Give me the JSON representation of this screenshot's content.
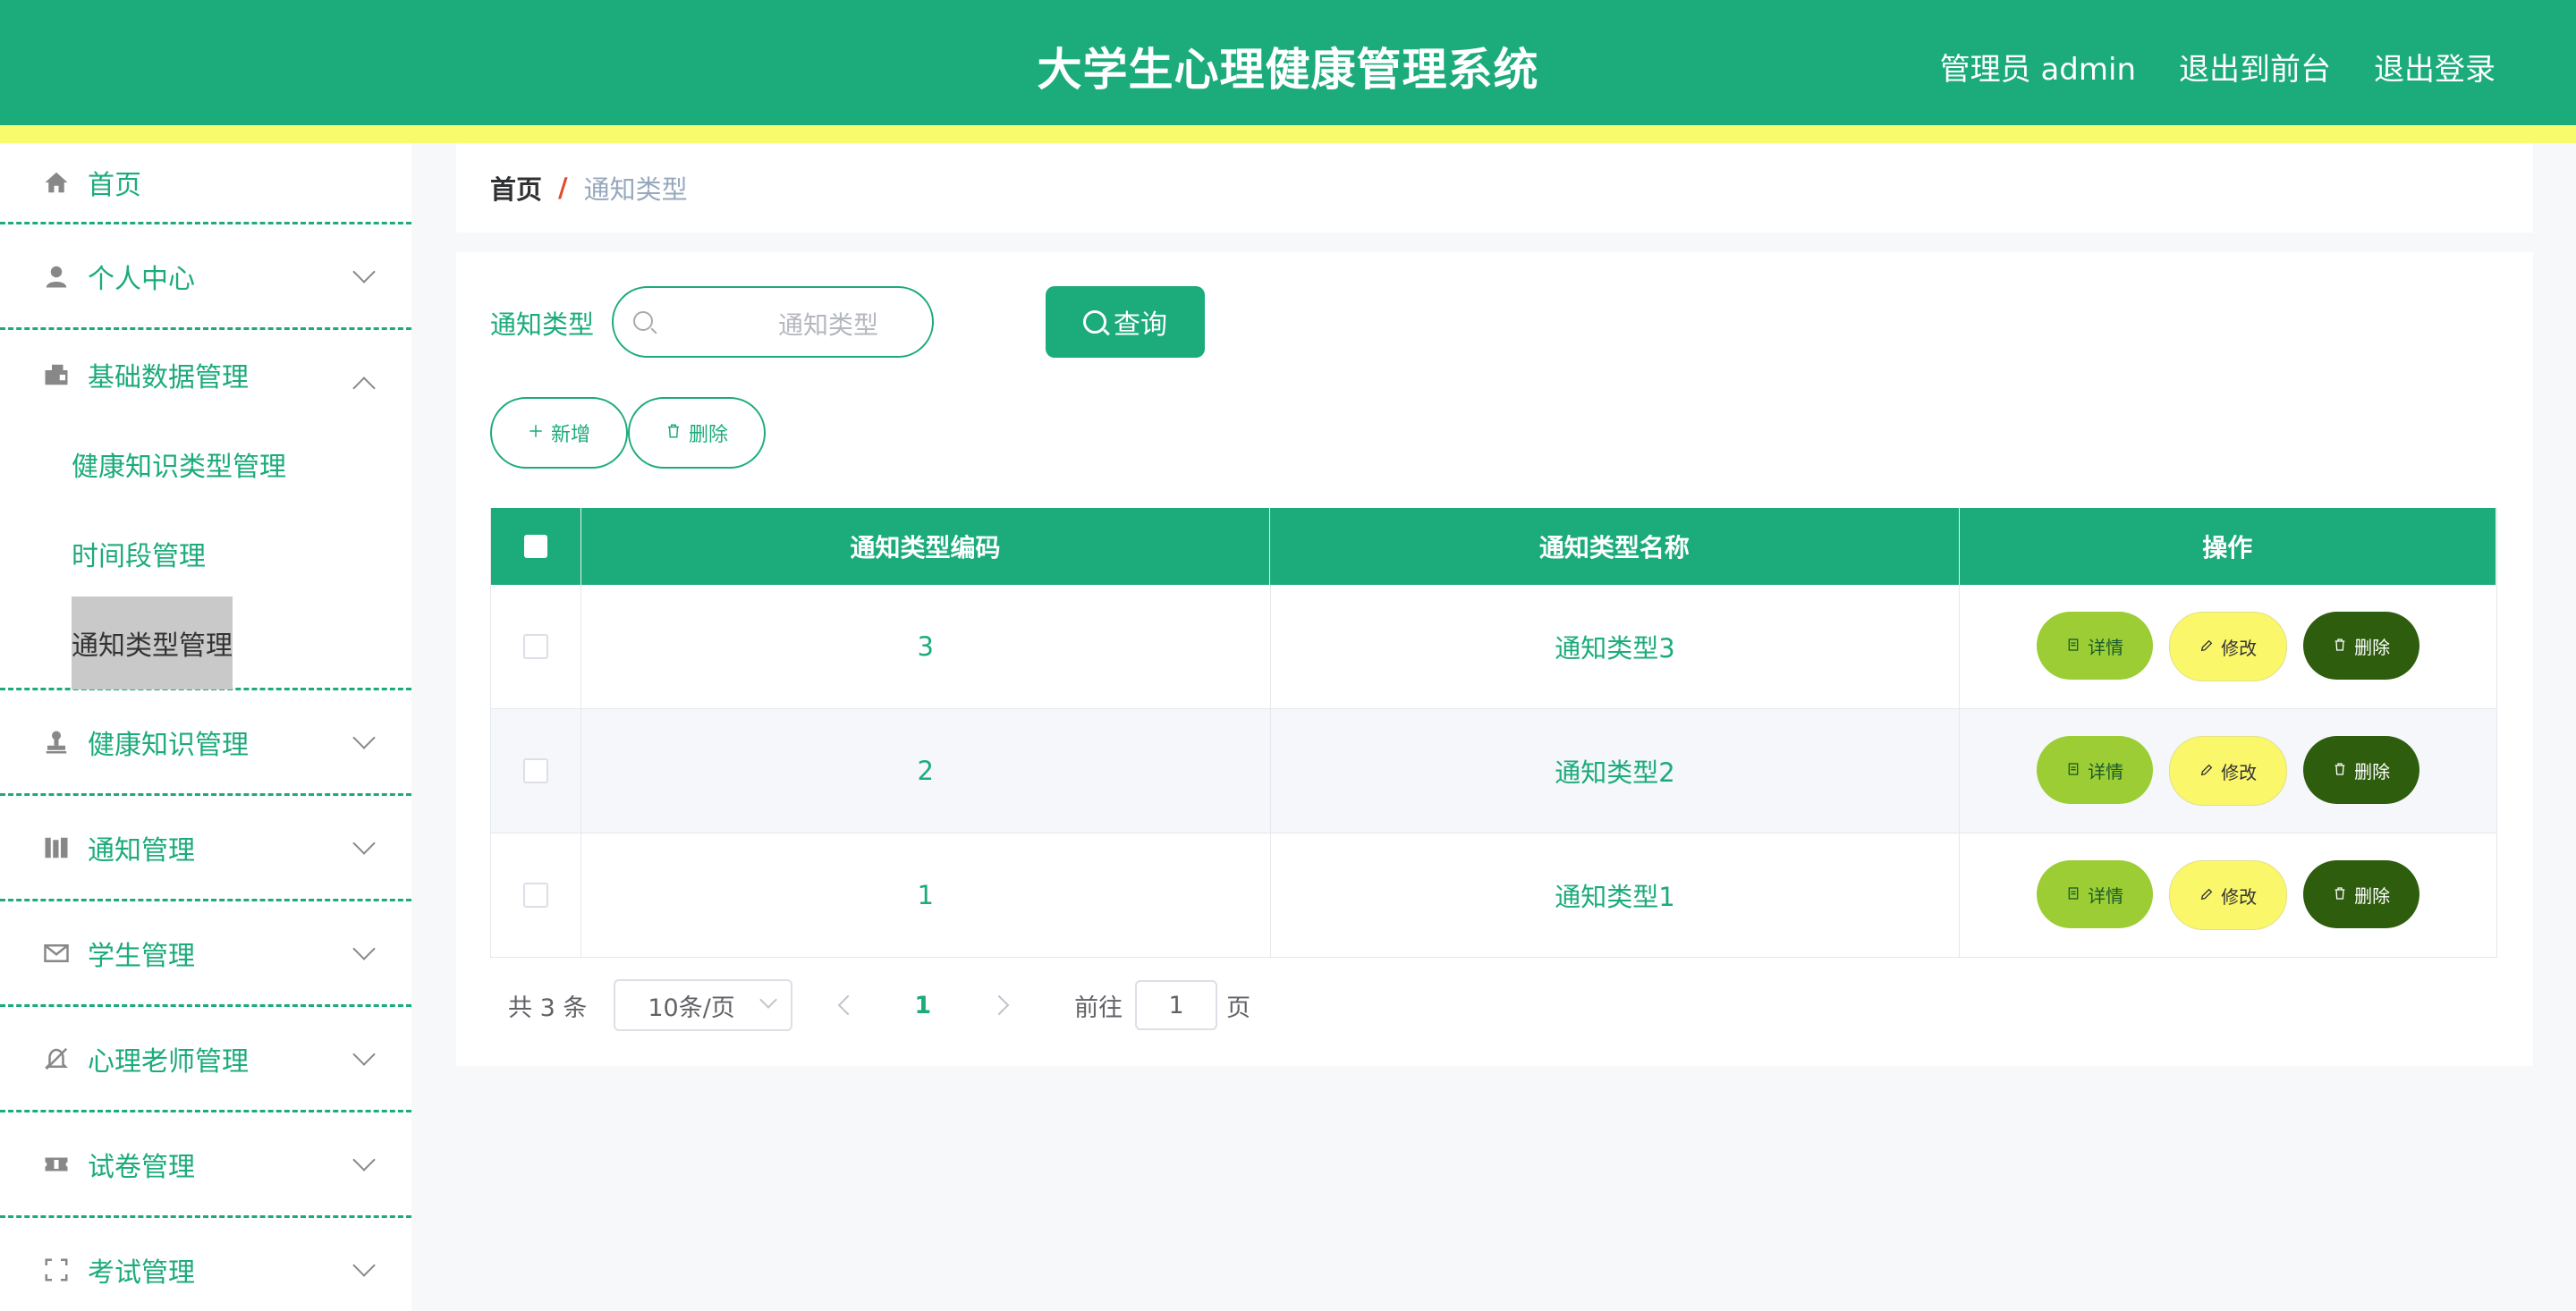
{
  "header": {
    "title": "大学生心理健康管理系统",
    "user": "管理员 admin",
    "to_front": "退出到前台",
    "logout": "退出登录"
  },
  "colors": {
    "primary": "#1cab7a",
    "stripe": "#f8fb6b"
  },
  "sidebar": {
    "home": "首页",
    "personal": "个人中心",
    "basic_data": "基础数据管理",
    "sub": [
      "健康知识类型管理",
      "时间段管理",
      "通知类型管理"
    ],
    "health_knowledge": "健康知识管理",
    "notice": "通知管理",
    "student": "学生管理",
    "teacher": "心理老师管理",
    "paper": "试卷管理",
    "exam": "考试管理"
  },
  "breadcrumb": {
    "home": "首页",
    "sep": "/",
    "current": "通知类型"
  },
  "search": {
    "label": "通知类型",
    "placeholder": "通知类型",
    "button": "查询"
  },
  "toolbar": {
    "add": "新增",
    "delete": "删除"
  },
  "table": {
    "columns": [
      "通知类型编码",
      "通知类型名称",
      "操作"
    ],
    "rows": [
      {
        "code": "3",
        "name": "通知类型3"
      },
      {
        "code": "2",
        "name": "通知类型2"
      },
      {
        "code": "1",
        "name": "通知类型1"
      }
    ],
    "actions": {
      "detail": "详情",
      "edit": "修改",
      "delete": "删除"
    }
  },
  "pagination": {
    "total": "共 3 条",
    "page_size": "10条/页",
    "current": "1",
    "goto_label": "前往",
    "goto_value": "1",
    "goto_unit": "页"
  }
}
